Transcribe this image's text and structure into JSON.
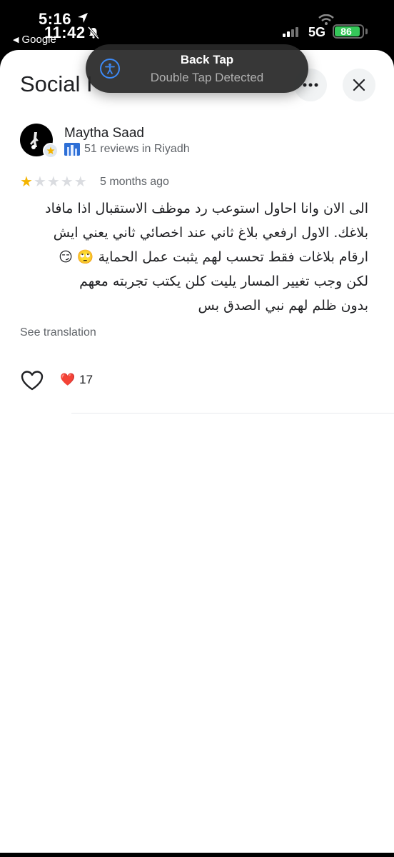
{
  "status_bar": {
    "time_primary": "5:16",
    "time_secondary": "11:42",
    "back_app": "Google",
    "network": "5G",
    "battery_percent": "86"
  },
  "toast": {
    "title": "Back Tap",
    "subtitle": "Double Tap Detected",
    "icon": "accessibility-icon"
  },
  "sheet": {
    "title": "Social I",
    "more_icon": "more-horizontal-icon",
    "close_icon": "close-icon"
  },
  "review": {
    "reviewer_name": "Maytha Saad",
    "reviewer_meta": "51 reviews in Riyadh",
    "rating": 1,
    "max_rating": 5,
    "date": "5 months ago",
    "text_lines": [
      "الى الان وانا احاول استوعب رد موظف الاستقبال اذا مافاد",
      "بلاغك. الاول ارفعي بلاغ ثاني عند اخصائي ثاني يعني ايش",
      "ارقام بلاغات فقط تحسب لهم يثبت عمل الحماية 🙄 😏",
      "لكن وجب تغيير المسار  يليت كلن يكتب تجربته معهم",
      "بدون ظلم لهم نبي الصدق بس"
    ],
    "see_translation": "See translation",
    "reaction_emoji": "❤️",
    "reaction_count": "17"
  },
  "colors": {
    "star_on": "#f4b400",
    "star_off": "#dadce0",
    "battery": "#35c759",
    "toast_accent": "#3d8af7"
  }
}
